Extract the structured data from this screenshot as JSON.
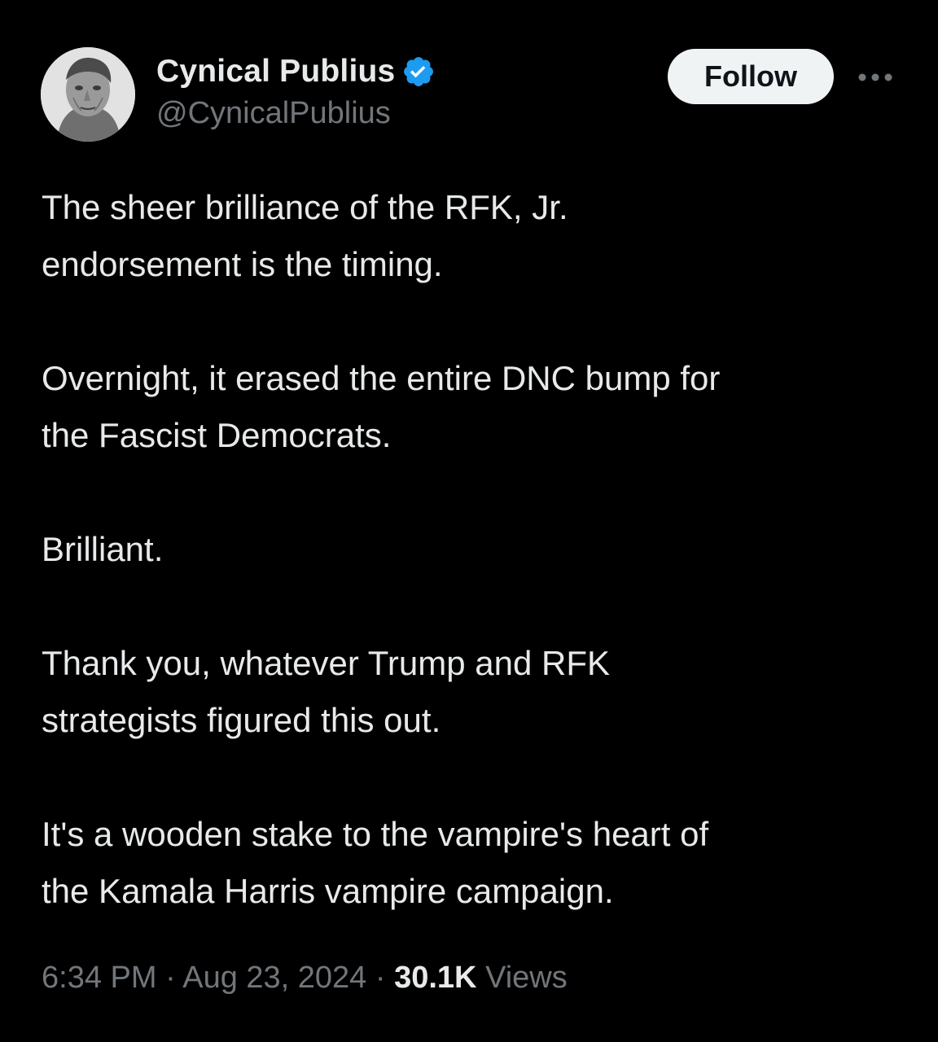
{
  "author": {
    "display_name": "Cynical Publius",
    "handle": "@CynicalPublius",
    "verified_icon": "verified-badge-icon",
    "verified_color": "#1d9bf0"
  },
  "follow_button": {
    "label": "Follow"
  },
  "more_menu": {
    "icon": "more-horizontal-icon"
  },
  "body": {
    "paragraphs": [
      "The sheer brilliance of the RFK, Jr.\nendorsement is the timing.",
      "Overnight, it erased the entire DNC bump for\nthe Fascist Democrats.",
      "Brilliant.",
      "Thank you, whatever Trump and RFK\nstrategists figured this out.",
      "It's a wooden stake to the vampire's heart of\nthe Kamala Harris vampire campaign."
    ]
  },
  "meta": {
    "time": "6:34 PM",
    "separator": "·",
    "date": "Aug 23, 2024",
    "views_count": "30.1K",
    "views_label": "Views"
  },
  "colors": {
    "background": "#000000",
    "primary_text": "#e7e9ea",
    "secondary_text": "#71767b",
    "button_bg": "#eff3f4"
  }
}
